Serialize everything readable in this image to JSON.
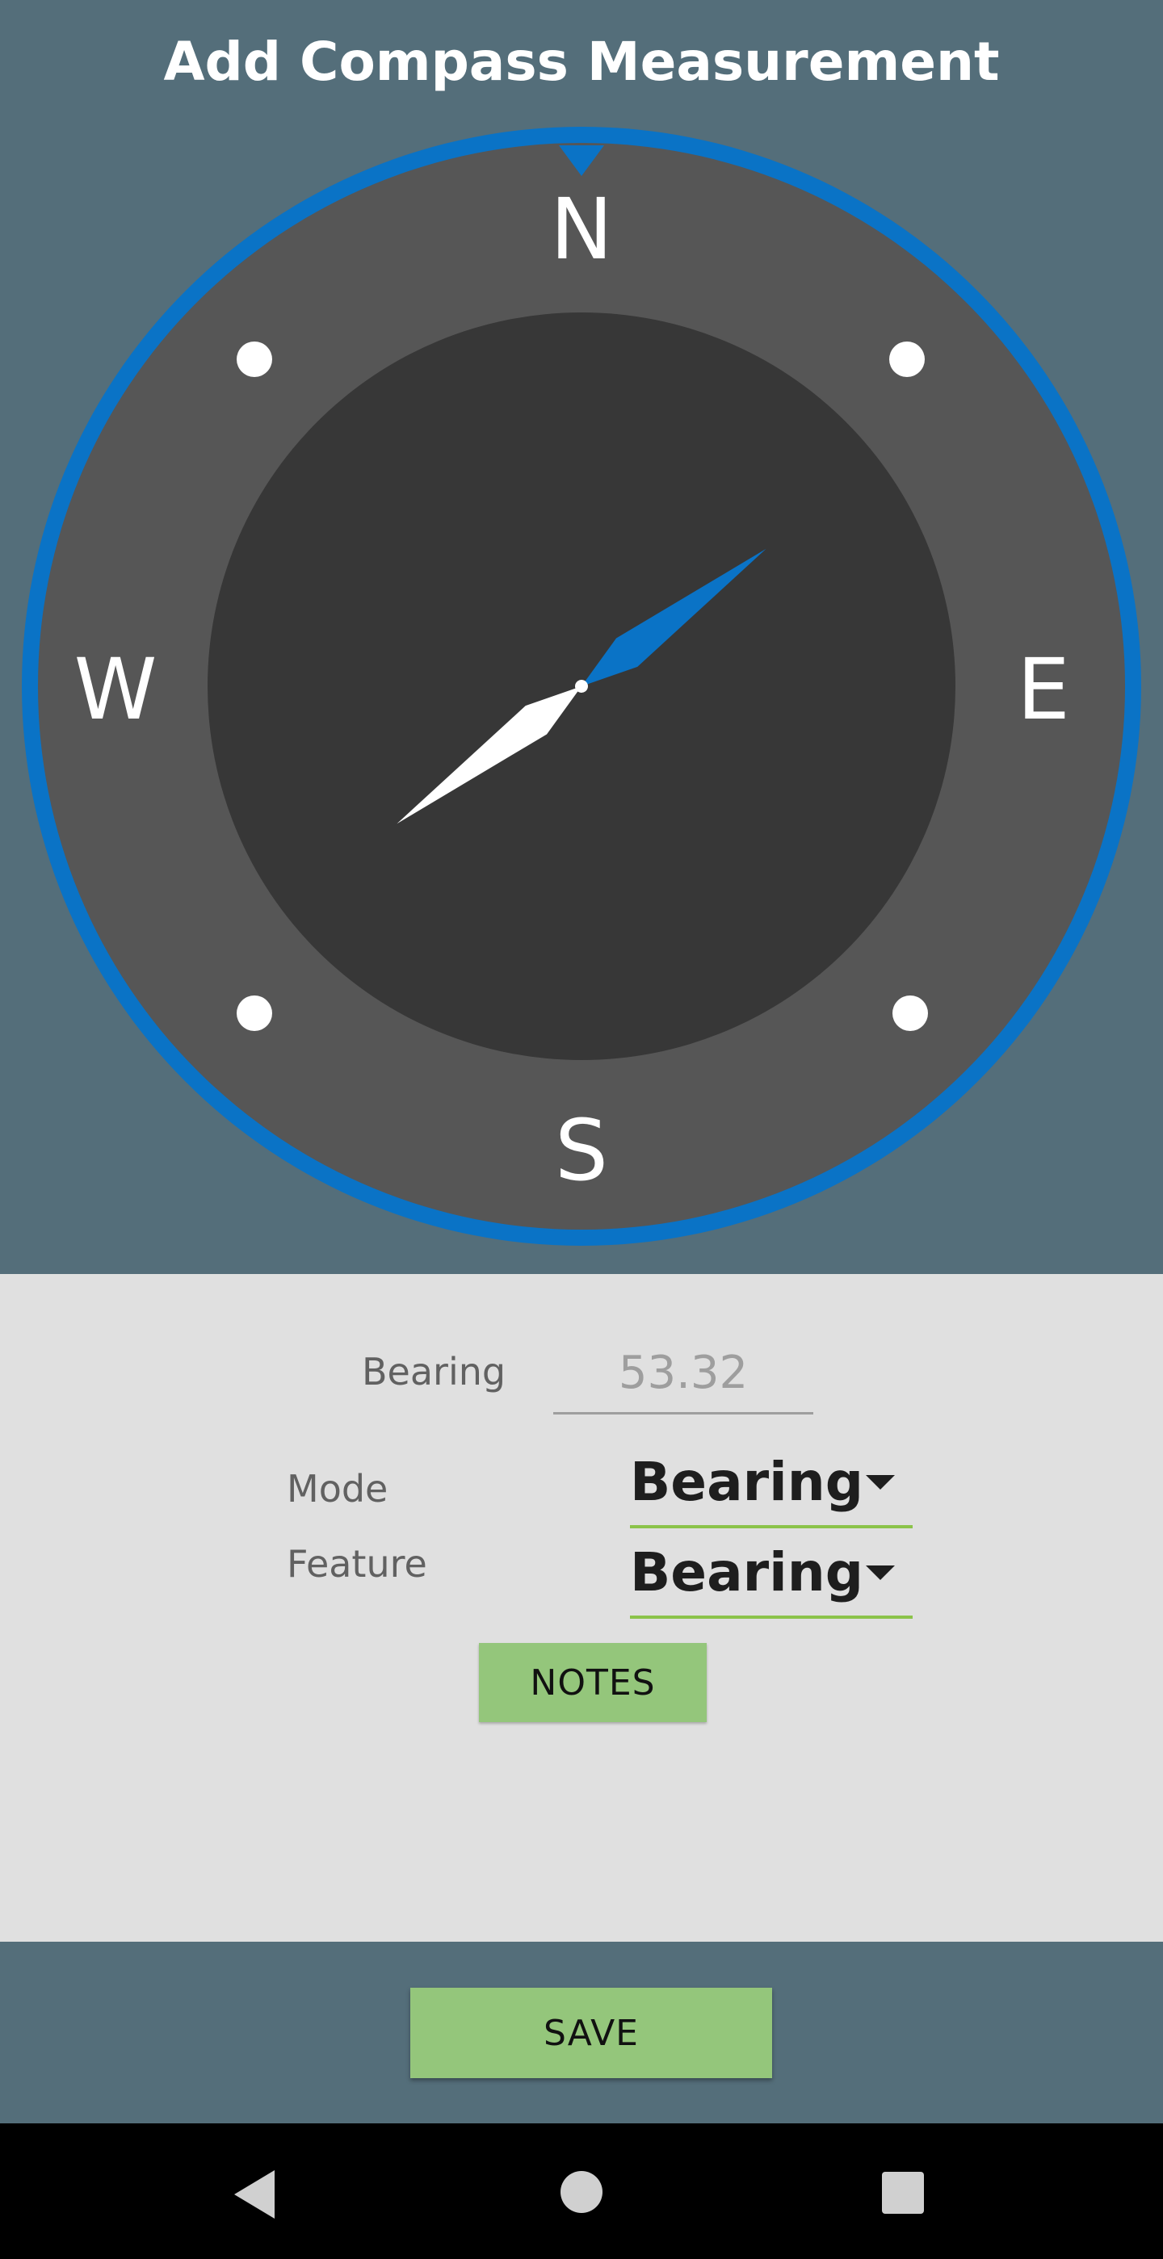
{
  "header": {
    "title": "Add Compass Measurement"
  },
  "compass": {
    "cardinals": {
      "north": "N",
      "east": "E",
      "south": "S",
      "west": "W"
    },
    "heading_degrees": 53.32,
    "colors": {
      "ring": "#0a73c6",
      "outer_dial": "#565656",
      "inner_dial": "#373737",
      "needle_north": "#0a73c6",
      "needle_south": "#ffffff"
    }
  },
  "form": {
    "bearing_label": "Bearing",
    "bearing_value": "53.32",
    "mode_label": "Mode",
    "mode_value": "Bearing",
    "feature_label": "Feature",
    "feature_value": "Bearing",
    "notes_button": "NOTES"
  },
  "footer": {
    "save_button": "SAVE"
  },
  "colors": {
    "header_bg": "#546e7a",
    "panel_bg": "#e0e0e0",
    "button_green": "#94c67b",
    "underline_green": "#8bc34a"
  },
  "navigation": {
    "back_icon": "back-triangle-icon",
    "home_icon": "home-circle-icon",
    "recents_icon": "recents-square-icon"
  }
}
